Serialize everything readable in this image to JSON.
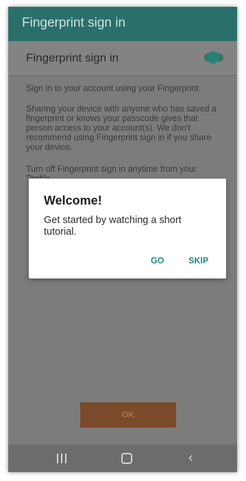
{
  "appbar": {
    "title": "Fingerprint sign in"
  },
  "setting": {
    "label": "Fingerprint sign in",
    "enabled": true
  },
  "description": {
    "p1": "Sign in to your account using your Fingerprint.",
    "p2": "Sharing your device with anyone who has saved a fingerprint or knows your passcode gives that person access to your account(s). We don't recommend using Fingerprint sign in if you share your device.",
    "p3": "Turn off Fingerprint sign in anytime from your Profile."
  },
  "dialog": {
    "title": "Welcome!",
    "body": "Get started by watching a short tutorial.",
    "go_label": "GO",
    "skip_label": "SKIP"
  },
  "ok_label": "OK",
  "navbar": {
    "recent": "recent-apps-icon",
    "home": "home-icon",
    "back": "back-icon"
  },
  "colors": {
    "accent": "#2a8a82",
    "appbar": "#2a6f69",
    "ok_button": "#7a4a2a"
  }
}
